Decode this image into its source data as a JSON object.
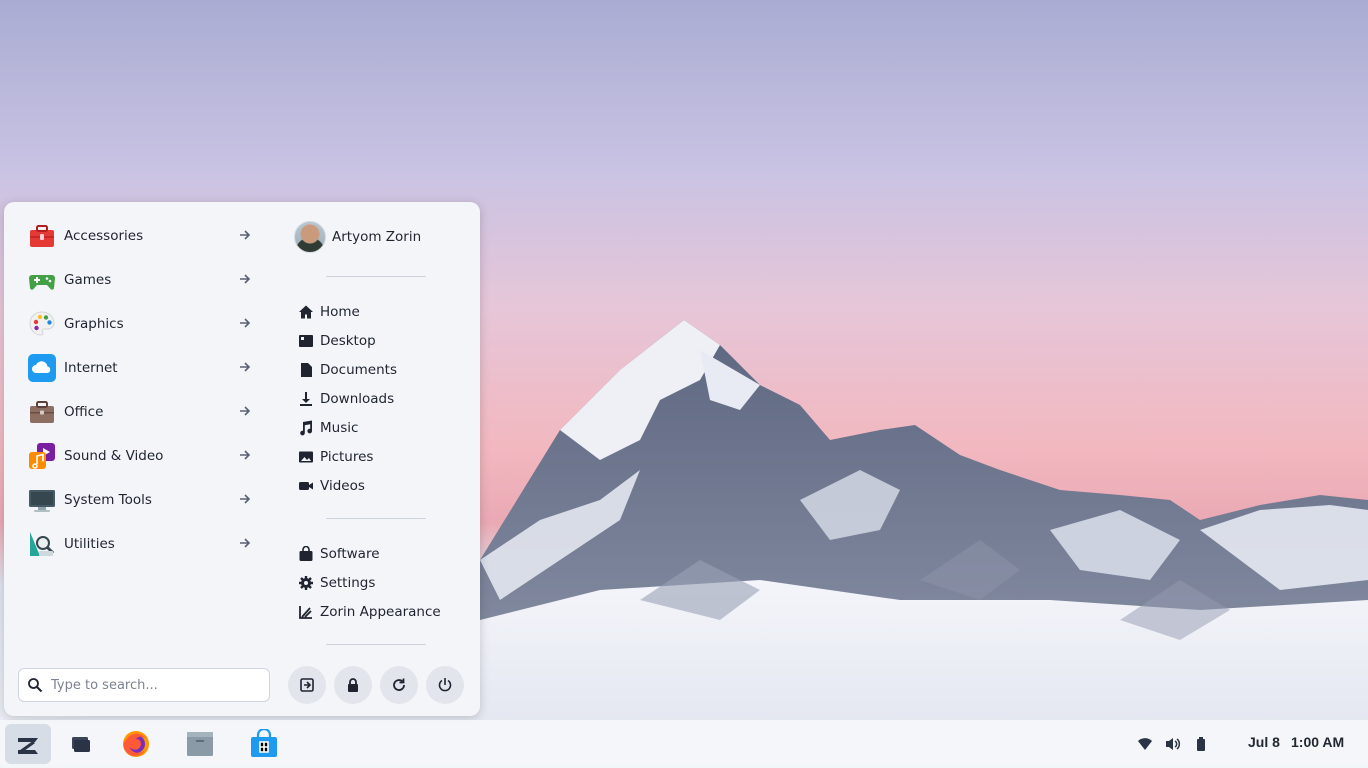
{
  "menu": {
    "categories": [
      {
        "label": "Accessories",
        "icon": "toolbox-icon"
      },
      {
        "label": "Games",
        "icon": "gamepad-icon"
      },
      {
        "label": "Graphics",
        "icon": "palette-icon"
      },
      {
        "label": "Internet",
        "icon": "cloud-icon"
      },
      {
        "label": "Office",
        "icon": "briefcase-icon"
      },
      {
        "label": "Sound & Video",
        "icon": "music-video-icon"
      },
      {
        "label": "System Tools",
        "icon": "monitor-icon"
      },
      {
        "label": "Utilities",
        "icon": "utilities-icon"
      }
    ],
    "user": {
      "name": "Artyom Zorin"
    },
    "places": [
      {
        "label": "Home",
        "icon": "home-icon"
      },
      {
        "label": "Desktop",
        "icon": "desktop-icon"
      },
      {
        "label": "Documents",
        "icon": "document-icon"
      },
      {
        "label": "Downloads",
        "icon": "download-icon"
      },
      {
        "label": "Music",
        "icon": "music-note-icon"
      },
      {
        "label": "Pictures",
        "icon": "picture-icon"
      },
      {
        "label": "Videos",
        "icon": "video-camera-icon"
      }
    ],
    "system": [
      {
        "label": "Software",
        "icon": "shopping-bag-icon"
      },
      {
        "label": "Settings",
        "icon": "gear-icon"
      },
      {
        "label": "Zorin Appearance",
        "icon": "appearance-icon"
      }
    ],
    "search": {
      "placeholder": "Type to search..."
    }
  },
  "taskbar": {
    "date": "Jul 8",
    "time": "1:00 AM"
  },
  "colors": {
    "menu_bg": "#f3f5f9",
    "text": "#1f2430",
    "accent_blue": "#1e9bf0"
  }
}
